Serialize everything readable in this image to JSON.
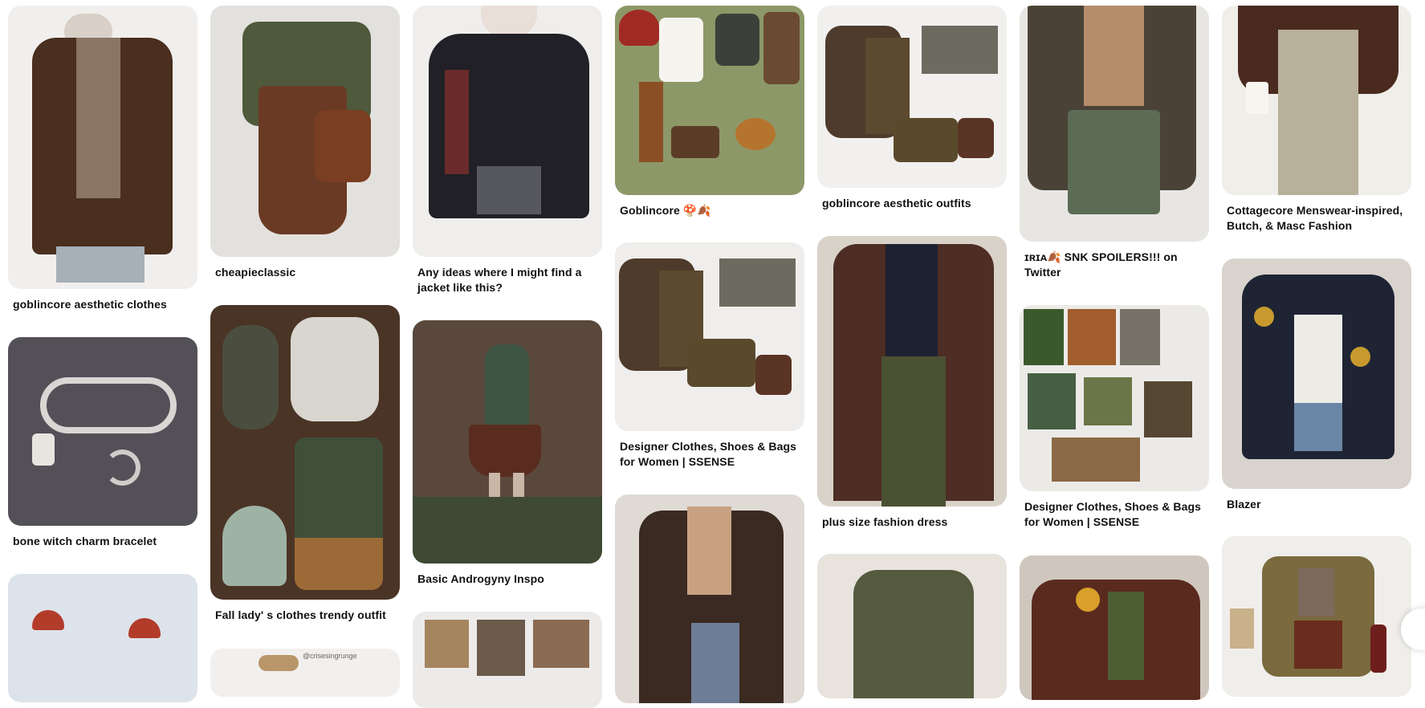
{
  "captions": {
    "c0_0": "goblincore aesthetic clothes",
    "c0_1": "bone witch charm bracelet",
    "c1_0": "cheapieclassic",
    "c1_1": "Fall lady' s clothes trendy outfit",
    "c2_0": "Any ideas where I might find a jacket like this?",
    "c2_1": "Basic Androgyny Inspo",
    "c3_0": "Goblincore 🍄🍂",
    "c3_1": "Designer Clothes, Shoes & Bags for Women | SSENSE",
    "c4_0": "goblincore aesthetic outfits",
    "c4_1": "plus size fashion dress",
    "c5_0": "ɪʀɪᴀ🍂 SNK SPOILERS!!! on Twitter",
    "c5_1": "Designer Clothes, Shoes & Bags for Women | SSENSE",
    "c6_0": "Cottagecore Menswear-inspired, Butch, & Masc Fashion",
    "c6_1": "Blazer"
  },
  "watermarks": {
    "fall_outfit_tag": "@crisesingrunge"
  },
  "colors": {
    "brown_coat": "#4a2e1e",
    "olive": "#8d9868",
    "forest_green": "#3f4f3a",
    "rust": "#6b3a25",
    "plaid_dark": "#3a2a22",
    "page_bg": "#ffffff"
  }
}
